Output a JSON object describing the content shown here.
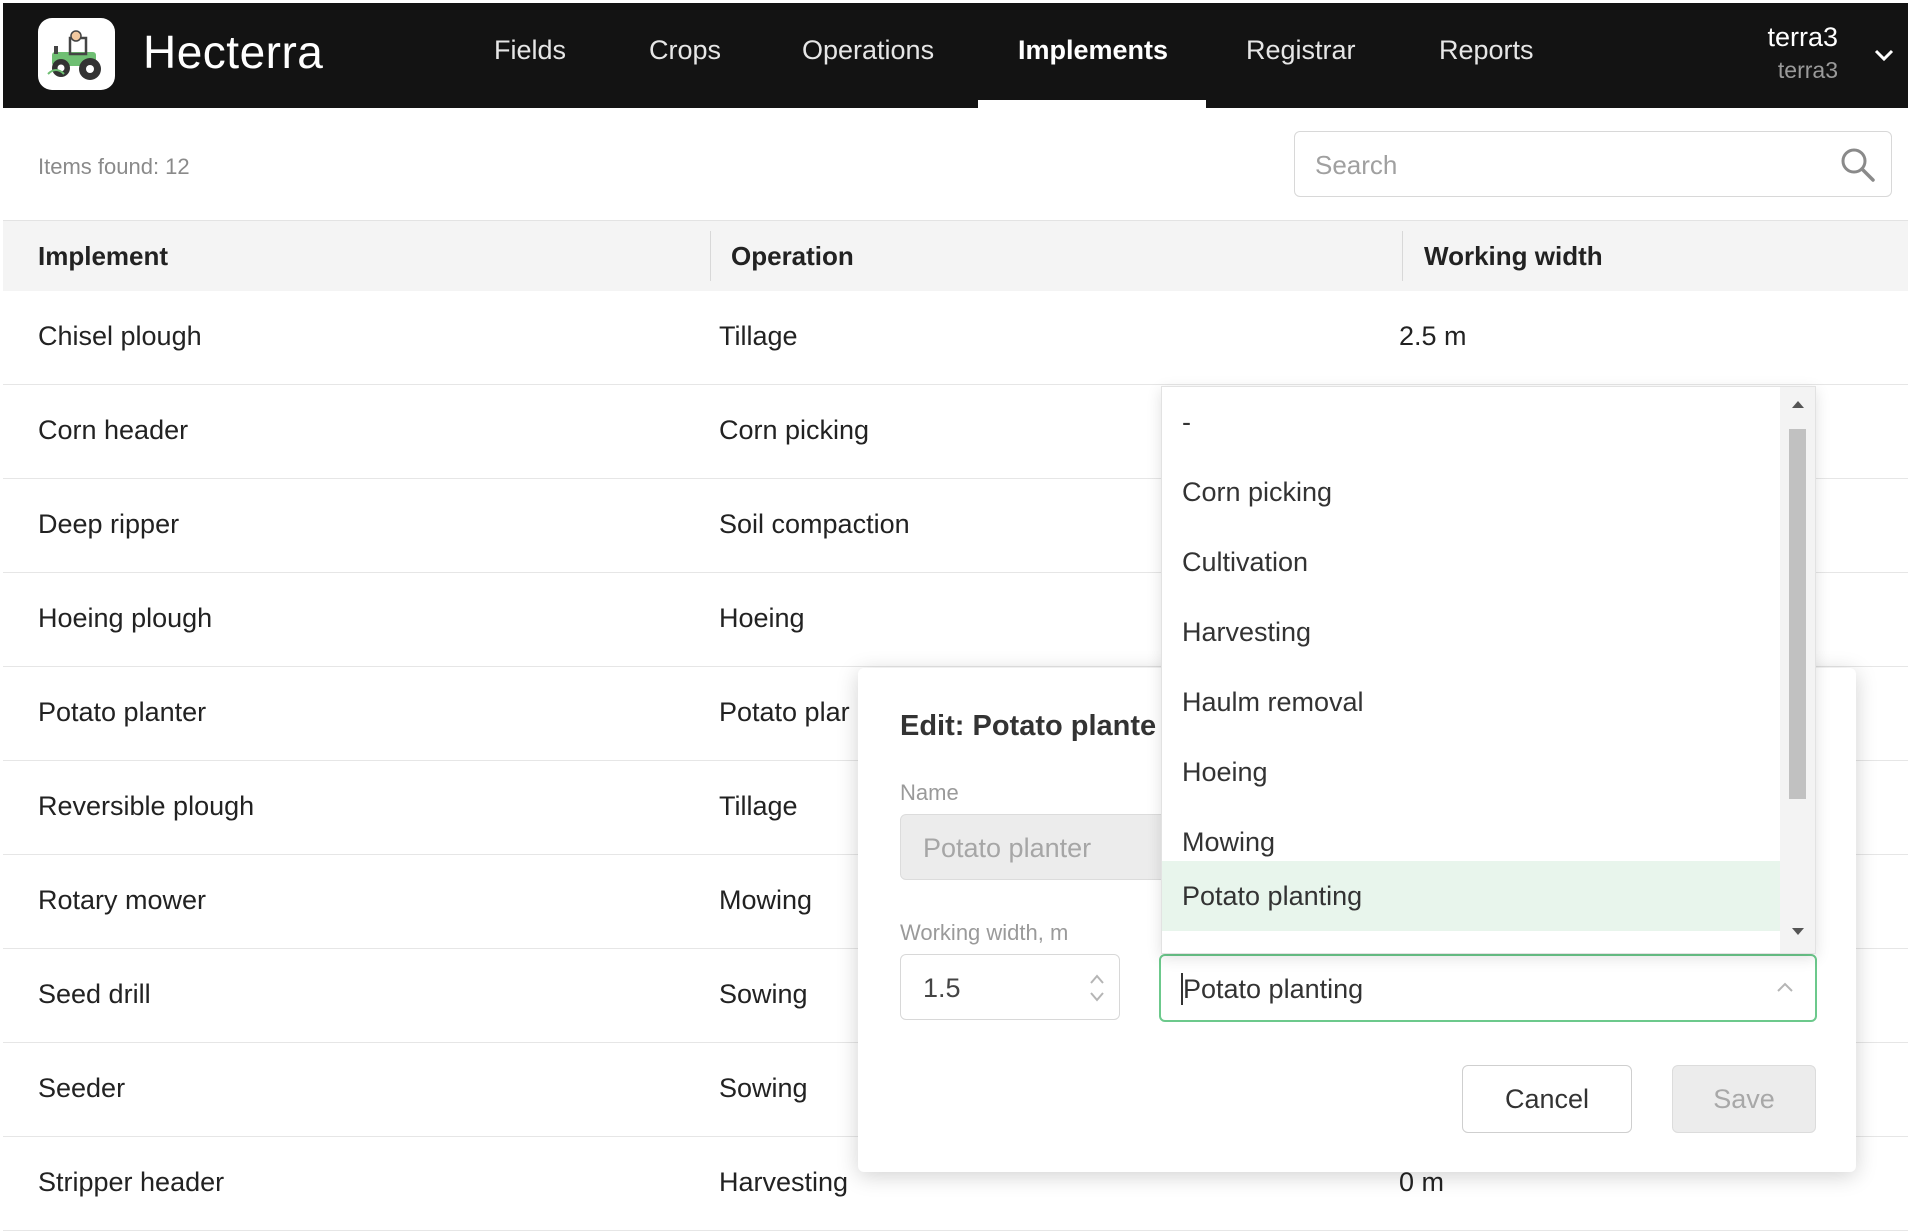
{
  "app": {
    "title": "Hecterra"
  },
  "nav": {
    "items": [
      {
        "label": "Fields"
      },
      {
        "label": "Crops"
      },
      {
        "label": "Operations"
      },
      {
        "label": "Implements"
      },
      {
        "label": "Registrar"
      },
      {
        "label": "Reports"
      }
    ],
    "active": "Implements"
  },
  "user": {
    "name": "terra3",
    "account": "terra3"
  },
  "toolbar": {
    "items_found": "Items found: 12",
    "search_placeholder": "Search"
  },
  "table": {
    "columns": [
      "Implement",
      "Operation",
      "Working width"
    ],
    "rows": [
      {
        "implement": "Chisel plough",
        "operation": "Tillage",
        "width": "2.5 m"
      },
      {
        "implement": "Corn header",
        "operation": "Corn picking",
        "width": ""
      },
      {
        "implement": "Deep ripper",
        "operation": "Soil compaction",
        "width": ""
      },
      {
        "implement": "Hoeing plough",
        "operation": "Hoeing",
        "width": ""
      },
      {
        "implement": "Potato planter",
        "operation": "Potato plar",
        "width": ""
      },
      {
        "implement": "Reversible plough",
        "operation": "Tillage",
        "width": ""
      },
      {
        "implement": "Rotary mower",
        "operation": "Mowing",
        "width": ""
      },
      {
        "implement": "Seed drill",
        "operation": "Sowing",
        "width": ""
      },
      {
        "implement": "Seeder",
        "operation": "Sowing",
        "width": ""
      },
      {
        "implement": "Stripper header",
        "operation": "Harvesting",
        "width": "0 m"
      }
    ]
  },
  "modal": {
    "title": "Edit: Potato plante",
    "name_label": "Name",
    "name_value": "Potato planter",
    "width_label": "Working width, m",
    "width_value": "1.5",
    "operation_value": "Potato planting",
    "cancel_label": "Cancel",
    "save_label": "Save"
  },
  "dropdown": {
    "options": [
      "-",
      "Corn picking",
      "Cultivation",
      "Harvesting",
      "Haulm removal",
      "Hoeing",
      "Mowing",
      "Potato planting"
    ],
    "selected": "Potato planting"
  },
  "colors": {
    "topbar": "#131313",
    "accent_green": "#6cc98c",
    "selected_bg": "#e8f5ec"
  }
}
